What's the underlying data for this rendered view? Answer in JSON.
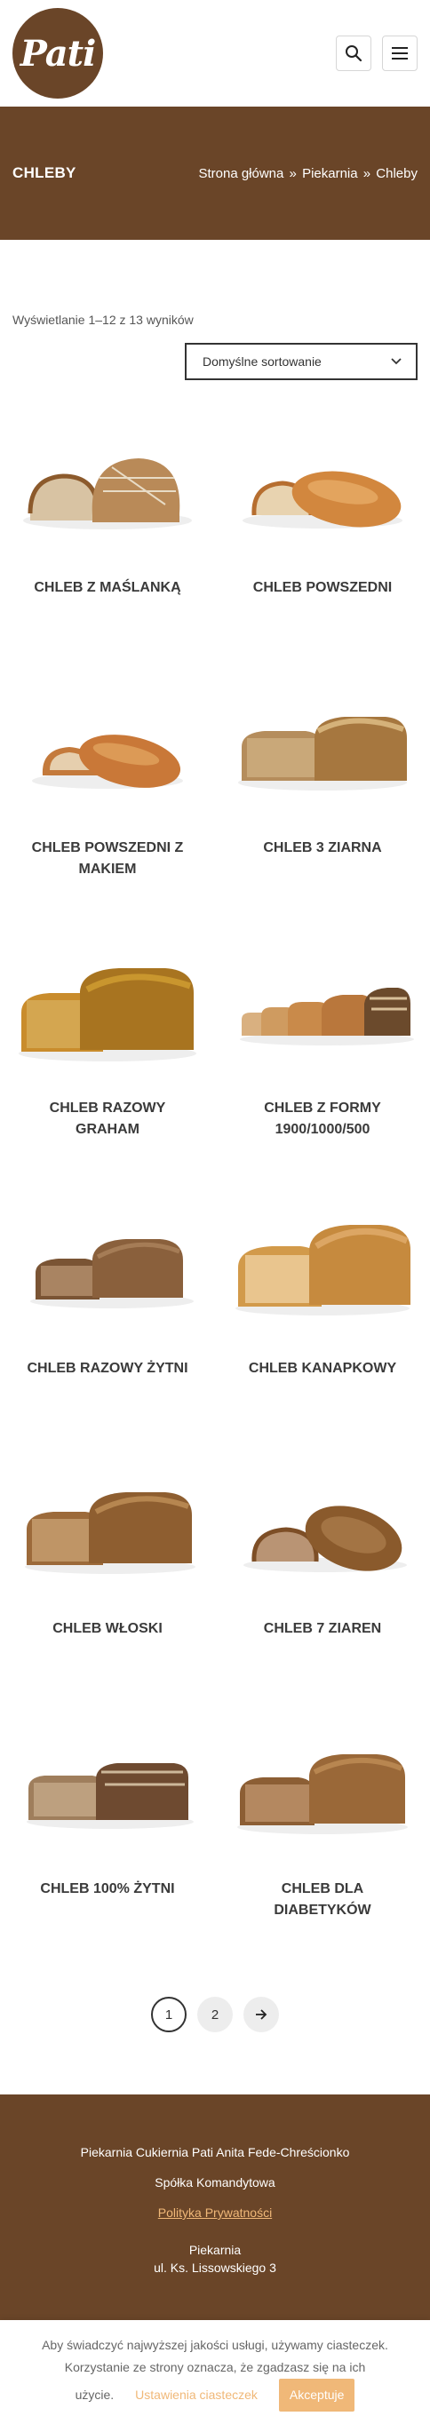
{
  "header": {
    "logo_text": "Pati",
    "search_icon": "search-icon",
    "menu_icon": "hamburger-menu-icon"
  },
  "title_bar": {
    "title": "CHLEBY",
    "breadcrumb": [
      "Strona główna",
      "Piekarnia",
      "Chleby"
    ],
    "separator": "»"
  },
  "shop": {
    "result_count": "Wyświetlanie 1–12 z 13 wyników",
    "sort_selected": "Domyślne sortowanie"
  },
  "products": [
    {
      "title": "CHLEB Z MAŚLANKĄ"
    },
    {
      "title": "CHLEB POWSZEDNI"
    },
    {
      "title": "CHLEB POWSZEDNI Z MAKIEM"
    },
    {
      "title": "CHLEB 3 ZIARNA"
    },
    {
      "title": "CHLEB RAZOWY GRAHAM"
    },
    {
      "title": "CHLEB Z FORMY 1900/1000/500"
    },
    {
      "title": "CHLEB RAZOWY ŻYTNI"
    },
    {
      "title": "CHLEB KANAPKOWY"
    },
    {
      "title": "CHLEB WŁOSKI"
    },
    {
      "title": "CHLEB 7 ZIAREN"
    },
    {
      "title": "CHLEB 100% ŻYTNI"
    },
    {
      "title": "CHLEB DLA DIABETYKÓW"
    }
  ],
  "pagination": {
    "pages": [
      "1",
      "2"
    ],
    "current": "1",
    "next_icon": "arrow-right-icon"
  },
  "footer": {
    "company_line1": "Piekarnia Cukiernia Pati Anita Fede-Chreścionko",
    "company_line2": "Spółka Komandytowa",
    "privacy_link": "Polityka Prywatności",
    "section_label": "Piekarnia",
    "address": "ul. Ks. Lissowskiego 3"
  },
  "cookie": {
    "text_line1": "Aby świadczyć najwyższej jakości usługi, używamy ciasteczek.",
    "text_line2": "Korzystanie ze strony oznacza, że zgadzasz się na ich",
    "text_line3": "użycie.",
    "settings_label": "Ustawienia ciasteczek",
    "accept_label": "Akceptuje"
  },
  "colors": {
    "brand_brown": "#6a4528",
    "accent_orange": "#f0b878"
  }
}
